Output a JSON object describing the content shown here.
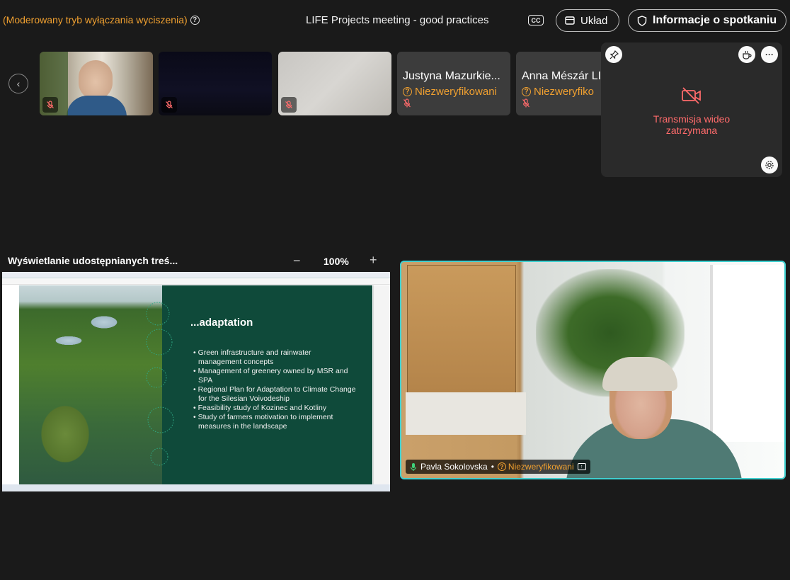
{
  "header": {
    "moderated_mode_text": "(Moderowany tryb wyłączania wyciszenia)",
    "meeting_title": "LIFE Projects meeting - good practices",
    "cc_label": "CC",
    "layout_button": "Układ",
    "meeting_info_button": "Informacje o spotkaniu"
  },
  "participants_strip": {
    "tiles": [
      {
        "type": "video"
      },
      {
        "type": "video"
      },
      {
        "type": "video"
      },
      {
        "type": "name",
        "name": "Justyna Mazurkie...",
        "status": "Niezweryfikowani"
      },
      {
        "type": "name",
        "name": "Anna Mészár LI",
        "status": "Niezweryfiko"
      }
    ]
  },
  "floating_panel": {
    "stopped_line1": "Transmisja wideo",
    "stopped_line2": "zatrzymana",
    "more_label": "···"
  },
  "share_panel": {
    "title": "Wyświetlanie udostępnianych treś...",
    "zoom_minus": "−",
    "zoom_level": "100%",
    "zoom_plus": "+",
    "slide": {
      "heading": "...adaptation",
      "bullets": [
        "• Green infrastructure and rainwater management concepts",
        "• Management of greenery owned by MSR and SPA",
        "• Regional Plan for Adaptation to Climate Change for the Silesian Voivodeship",
        "• Feasibility study of Kozinec and Kotliny",
        "• Study of farmers motivation to implement measures in the landscape"
      ]
    }
  },
  "active_speaker": {
    "name": "Pavla Sokolovska",
    "separator": "•",
    "status": "Niezweryfikowani",
    "accent_color": "#3fd0d0"
  }
}
